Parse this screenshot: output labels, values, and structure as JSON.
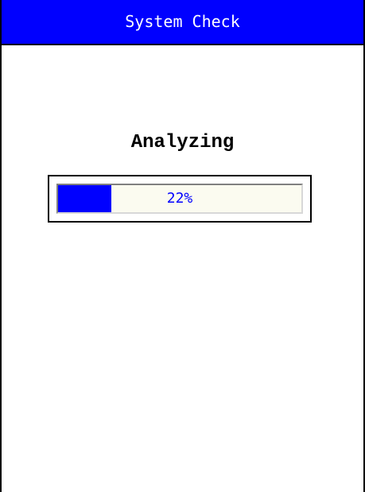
{
  "window": {
    "title": "System Check"
  },
  "status": {
    "label": "Analyzing"
  },
  "progress": {
    "percent": 22,
    "text": "22%"
  },
  "colors": {
    "titlebar_bg": "#0000ff",
    "titlebar_text": "#ffffff",
    "progress_fill": "#0000ff",
    "progress_text": "#0000ff"
  }
}
